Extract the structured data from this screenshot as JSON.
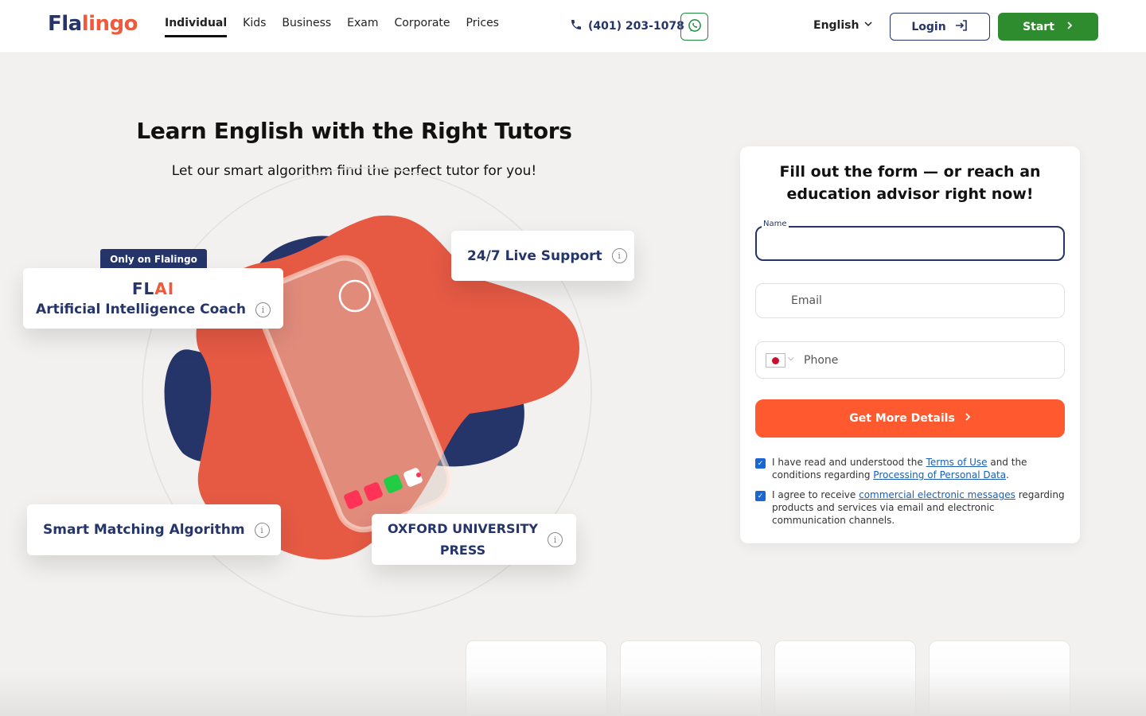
{
  "header": {
    "logo": {
      "part1": "Fla",
      "part2": "lingo"
    },
    "nav": [
      {
        "label": "Individual",
        "active": true
      },
      {
        "label": "Kids",
        "active": false
      },
      {
        "label": "Business",
        "active": false
      },
      {
        "label": "Exam",
        "active": false
      },
      {
        "label": "Corporate",
        "active": false
      },
      {
        "label": "Prices",
        "active": false
      }
    ],
    "phone": "(401) 203-1078",
    "whatsapp_icon": "whatsapp-icon",
    "language": "English",
    "login_label": "Login",
    "start_label": "Start"
  },
  "hero": {
    "title": "Learn English with the Right Tutors",
    "subtitle": "Let our smart algorithm find the perfect tutor for you!",
    "badge": "Only on Flalingo",
    "ai_logo": "FL",
    "ai_logo_accent": "AI",
    "cards": {
      "ai": "Artificial Intelligence Coach",
      "support": "24/7 Live Support",
      "matching": "Smart Matching Algorithm",
      "oxford_line1": "OXFORD UNIVERSITY",
      "oxford_line2": "PRESS"
    },
    "colors": {
      "navy": "#25356a",
      "coral": "#e65a44",
      "accent": "#f05a3a"
    }
  },
  "form": {
    "title": "Fill out the form — or reach an education advisor right now!",
    "name_label": "Name",
    "email_placeholder": "Email",
    "phone_placeholder": "Phone",
    "submit_label": "Get More Details",
    "consent1": {
      "prefix": "I have read and understood the ",
      "link1": "Terms of Use",
      "middle": " and the conditions regarding ",
      "link2": "Processing of Personal Data",
      "suffix": "."
    },
    "consent2": {
      "prefix": "I agree to receive ",
      "link": "commercial electronic messages",
      "suffix": " regarding products and services via email and electronic communication channels."
    }
  }
}
